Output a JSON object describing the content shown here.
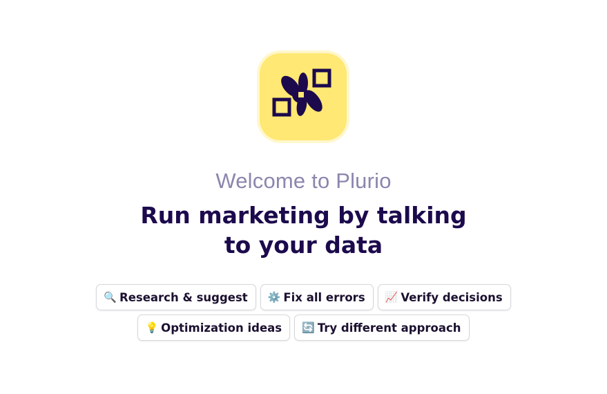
{
  "logo": {
    "icon": "plurio-flower-icon",
    "bg_color": "#ffe873",
    "mark_color": "#1c0a4d"
  },
  "welcome": {
    "title": "Welcome to Plurio"
  },
  "headline": {
    "line1": "Run marketing by talking",
    "line2": "to your data"
  },
  "suggestions": [
    {
      "icon": "🔍",
      "icon_name": "magnifier-icon",
      "label": "Research & suggest"
    },
    {
      "icon": "⚙️",
      "icon_name": "gear-icon",
      "label": "Fix all errors"
    },
    {
      "icon": "📈",
      "icon_name": "chart-up-icon",
      "label": "Verify decisions"
    },
    {
      "icon": "💡",
      "icon_name": "lightbulb-icon",
      "label": "Optimization ideas"
    },
    {
      "icon": "🔄",
      "icon_name": "refresh-icon",
      "label": "Try different approach"
    }
  ]
}
